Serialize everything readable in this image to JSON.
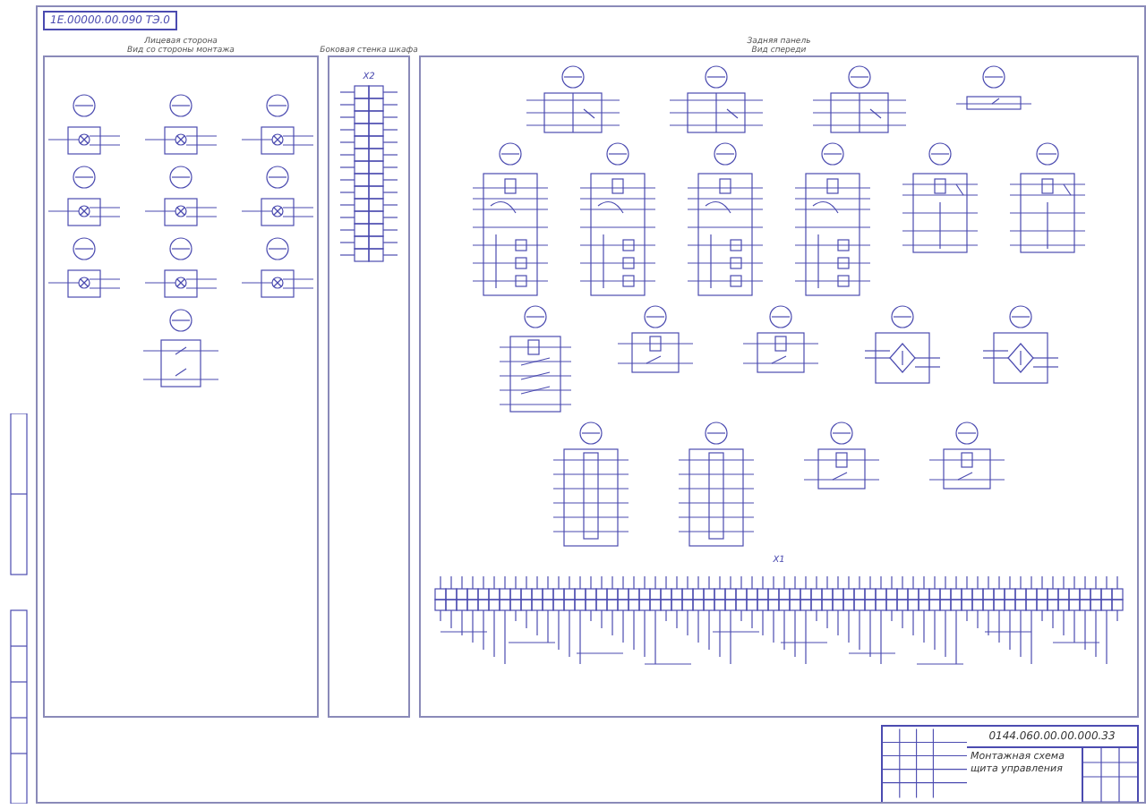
{
  "sheet": {
    "stamp": "1Е.00000.00.090 ТЭ.0"
  },
  "panels": [
    {
      "kind": "front",
      "heading": [
        "Лицевая сторона",
        "Вид со стороны монтажа"
      ],
      "rows": [
        [
          {
            "kind": "lamp"
          },
          {
            "kind": "lamp"
          },
          {
            "kind": "lamp"
          }
        ],
        [
          {
            "kind": "lamp"
          },
          {
            "kind": "lamp"
          },
          {
            "kind": "lamp"
          }
        ],
        [
          {
            "kind": "lamp"
          },
          {
            "kind": "lamp"
          },
          {
            "kind": "lamp"
          }
        ],
        [
          {
            "kind": "switch"
          }
        ]
      ]
    },
    {
      "kind": "side",
      "heading": [
        "Боковая стенка шкафа"
      ],
      "terminal_label": "X2"
    },
    {
      "kind": "rear",
      "heading": [
        "Задняя панель",
        "Вид спереди"
      ],
      "rows": [
        [
          {
            "kind": "selector"
          },
          {
            "kind": "selector"
          },
          {
            "kind": "selector"
          },
          {
            "kind": "button"
          }
        ],
        [
          {
            "kind": "contactor"
          },
          {
            "kind": "contactor"
          },
          {
            "kind": "contactor"
          },
          {
            "kind": "contactor"
          },
          {
            "kind": "relay_block"
          },
          {
            "kind": "relay_block"
          }
        ],
        [
          {
            "kind": "relay_multi"
          },
          {
            "kind": "relay"
          },
          {
            "kind": "relay"
          },
          {
            "kind": "bridge"
          },
          {
            "kind": "bridge"
          }
        ],
        [
          {
            "kind": "tall_block"
          },
          {
            "kind": "tall_block"
          },
          {
            "kind": "relay"
          },
          {
            "kind": "relay"
          }
        ]
      ],
      "terminal_label": "X1"
    }
  ],
  "title_block": {
    "designation": "0144.060.00.00.000.33",
    "title": [
      "Монтажная схема",
      "щита управления"
    ]
  }
}
